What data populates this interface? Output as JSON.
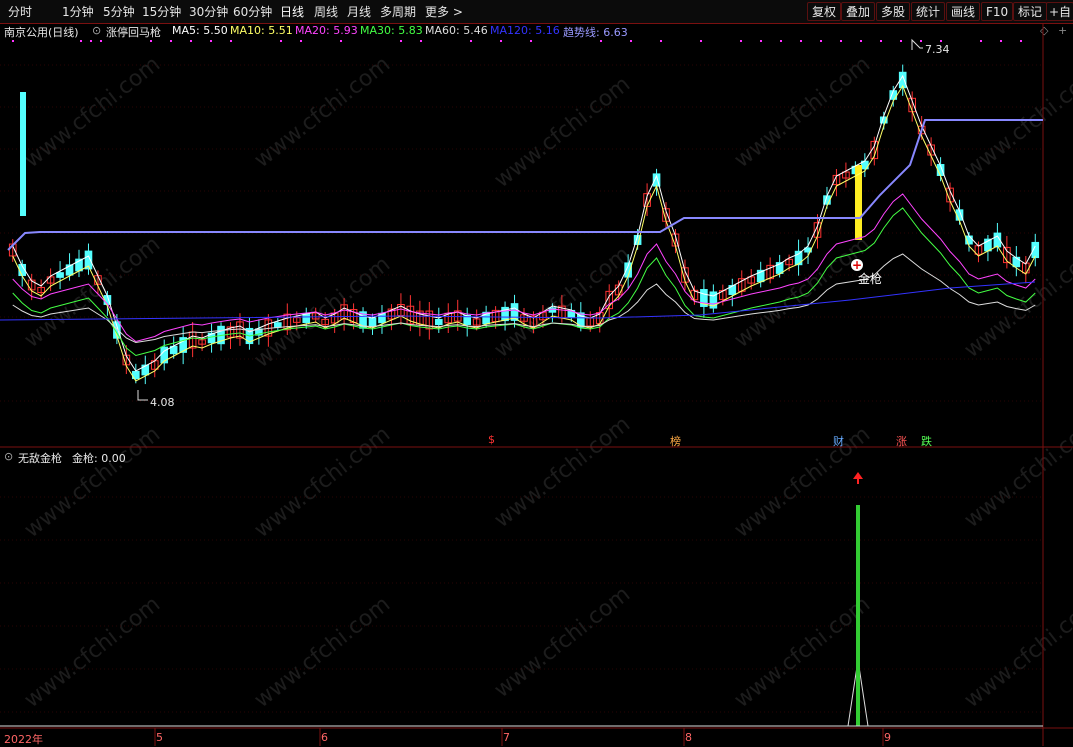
{
  "toolbar": {
    "periods": [
      "分时",
      "1分钟",
      "5分钟",
      "15分钟",
      "30分钟",
      "60分钟",
      "日线",
      "周线",
      "月线",
      "多周期",
      "更多 >"
    ],
    "right_buttons": [
      "复权",
      "叠加",
      "多股",
      "统计",
      "画线",
      "F10",
      "标记",
      "+自"
    ]
  },
  "main_panel": {
    "stock_title": "南京公用(日线)",
    "indicator_name": "涨停回马枪",
    "ma": [
      {
        "label": "MA5: 5.50",
        "color": "#ffffff"
      },
      {
        "label": "MA10: 5.51",
        "color": "#ffff66"
      },
      {
        "label": "MA20: 5.93",
        "color": "#ff44ff"
      },
      {
        "label": "MA30: 5.83",
        "color": "#44ff44"
      },
      {
        "label": "MA60: 5.46",
        "color": "#dddddd"
      },
      {
        "label": "MA120: 5.16",
        "color": "#3333ff"
      },
      {
        "label": "趋势线: 6.63",
        "color": "#9999ff"
      }
    ],
    "high_label": "7.34",
    "low_label": "4.08",
    "signal_label": "金枪",
    "event_markers": [
      {
        "text": "$",
        "color": "#ff3333"
      },
      {
        "text": "榜",
        "color": "#ffaa44"
      },
      {
        "text": "财",
        "color": "#66aaff"
      },
      {
        "text": "涨",
        "color": "#ff5555"
      },
      {
        "text": "跌",
        "color": "#55ff55"
      }
    ]
  },
  "sub_panel": {
    "indicator_name": "无敌金枪",
    "value_label": "金枪: 0.00"
  },
  "x_axis": {
    "labels": [
      "2022年",
      "5",
      "6",
      "7",
      "8",
      "9"
    ]
  },
  "watermark": "www.cfchi.com",
  "colors": {
    "up": "#ff3333",
    "down": "#54ffff",
    "trend": "#8888ff",
    "signal_bar": "#33cc33",
    "grid": "#7a1010"
  }
}
